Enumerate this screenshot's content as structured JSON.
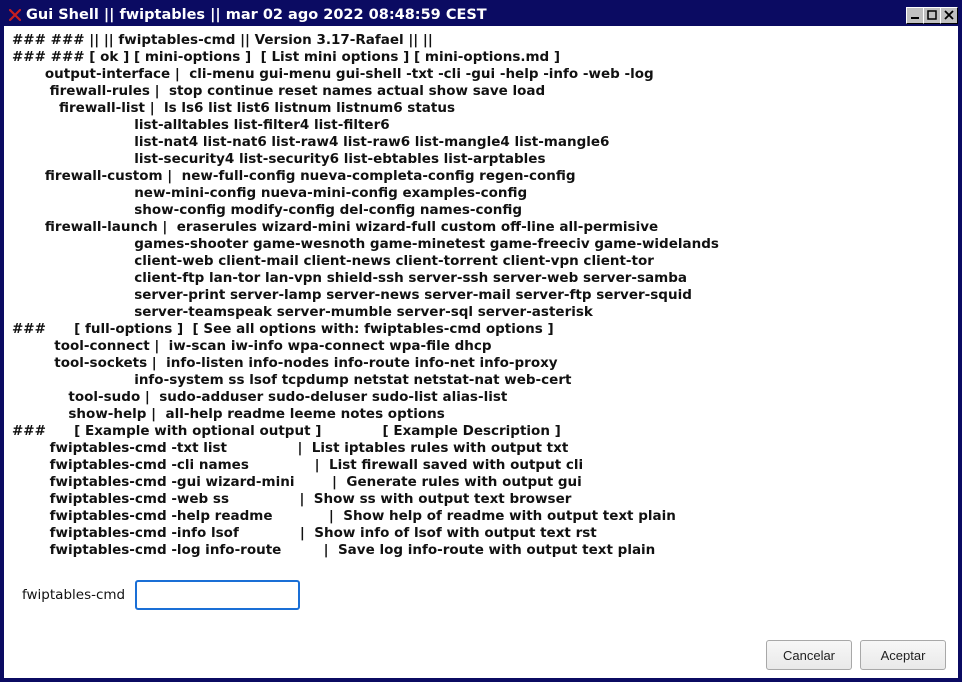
{
  "window": {
    "title": "Gui Shell || fwiptables || mar 02 ago 2022 08:48:59 CEST"
  },
  "output": {
    "lines": [
      "### ### || || fwiptables-cmd || Version 3.17-Rafael || ||",
      "### ### [ ok ] [ mini-options ]  [ List mini options ] [ mini-options.md ]",
      "       output-interface |  cli-menu gui-menu gui-shell -txt -cli -gui -help -info -web -log",
      "        firewall-rules |  stop continue reset names actual show save load",
      "          firewall-list |  ls ls6 list list6 listnum listnum6 status",
      "                          list-alltables list-filter4 list-filter6",
      "                          list-nat4 list-nat6 list-raw4 list-raw6 list-mangle4 list-mangle6",
      "                          list-security4 list-security6 list-ebtables list-arptables",
      "       firewall-custom |  new-full-config nueva-completa-config regen-config",
      "                          new-mini-config nueva-mini-config examples-config",
      "                          show-config modify-config del-config names-config",
      "       firewall-launch |  eraserules wizard-mini wizard-full custom off-line all-permisive",
      "                          games-shooter game-wesnoth game-minetest game-freeciv game-widelands",
      "                          client-web client-mail client-news client-torrent client-vpn client-tor",
      "                          client-ftp lan-tor lan-vpn shield-ssh server-ssh server-web server-samba",
      "                          server-print server-lamp server-news server-mail server-ftp server-squid",
      "                          server-teamspeak server-mumble server-sql server-asterisk",
      "###      [ full-options ]  [ See all options with: fwiptables-cmd options ]",
      "         tool-connect |  iw-scan iw-info wpa-connect wpa-file dhcp",
      "         tool-sockets |  info-listen info-nodes info-route info-net info-proxy",
      "                          info-system ss lsof tcpdump netstat netstat-nat web-cert",
      "            tool-sudo |  sudo-adduser sudo-deluser sudo-list alias-list",
      "            show-help |  all-help readme leeme notes options",
      "###      [ Example with optional output ]             [ Example Description ]",
      "        fwiptables-cmd -txt list               |  List iptables rules with output txt",
      "        fwiptables-cmd -cli names              |  List firewall saved with output cli",
      "        fwiptables-cmd -gui wizard-mini        |  Generate rules with output gui",
      "        fwiptables-cmd -web ss               |  Show ss with output text browser",
      "        fwiptables-cmd -help readme            |  Show help of readme with output text plain",
      "        fwiptables-cmd -info lsof             |  Show info of lsof with output text rst",
      "        fwiptables-cmd -log info-route         |  Save log info-route with output text plain"
    ]
  },
  "cmd": {
    "label": "fwiptables-cmd",
    "value": "",
    "placeholder": ""
  },
  "buttons": {
    "cancel": "Cancelar",
    "accept": "Aceptar"
  },
  "icons": {
    "app": "app-x-icon",
    "minimize": "minimize-icon",
    "maximize": "maximize-icon",
    "close": "close-icon"
  }
}
